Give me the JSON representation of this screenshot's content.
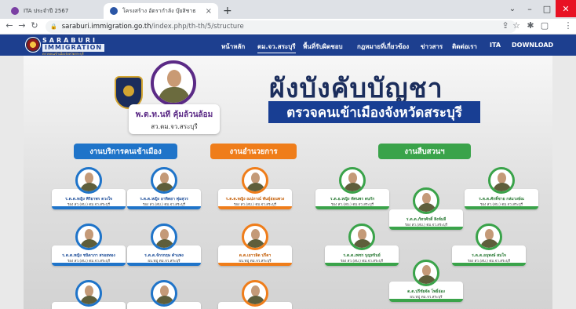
{
  "browser": {
    "tabs": [
      {
        "title": "ITA ประจำปี 2567",
        "close": "×"
      },
      {
        "title": "โครงสร้าง อัตรากำลัง บุ๊ยสิชาธ",
        "close": "×"
      }
    ],
    "new_tab": "+",
    "url_host": "saraburi.immigration.go.th",
    "url_path": "/index.php/th-th/5/structure",
    "window_controls": {
      "chevron": "⌄",
      "minimize": "–",
      "maximize": "□",
      "close": "✕"
    },
    "toolbar_icons": {
      "back": "←",
      "forward": "→",
      "reload": "↻",
      "share": "⇪",
      "star": "☆",
      "extensions": "✱",
      "sidepanel": "▢",
      "menu": "⋮"
    }
  },
  "site": {
    "logo_top": "SARABURI",
    "logo_mid": "IMMIGRATION",
    "logo_sub": "ตรวจคนเข้าเมืองจังหวัดสระบุรี",
    "nav": [
      {
        "label": "หน้าหลัก",
        "active": false
      },
      {
        "label": "ตม.จว.สระบุรี",
        "active": true
      },
      {
        "label": "พื้นที่รับผิดชอบ",
        "active": false
      },
      {
        "label": "กฎหมายที่เกี่ยวข้อง",
        "active": false
      },
      {
        "label": "ข่าวสาร",
        "active": false
      },
      {
        "label": "ติดต่อเรา",
        "active": false
      },
      {
        "label": "ITA",
        "active": false
      },
      {
        "label": "DOWNLOAD",
        "active": false
      }
    ]
  },
  "poster": {
    "title": "ผังบังคับบัญชา",
    "subtitle": "ตรวจคนเข้าเมืองจังหวัดสระบุรี",
    "chief": {
      "name": "พ.ต.ท.นที คุ้มล้วนล้อม",
      "title": "สว.ตม.จว.สระบุรี"
    },
    "sections": [
      "งานบริการคนเข้าเมือง",
      "งานอำนวยการ",
      "งานสืบสวนฯ"
    ],
    "people": [
      {
        "group": "blue",
        "name": "ร.ต.ต.หญิง พิริยาพร ดวงใจ",
        "role": "รอง สว.(สบ.) ตม.จว.สระบุรี"
      },
      {
        "group": "blue",
        "name": "ร.ต.ต.หญิง อาทิตยา พุ่มสุวร",
        "role": "รอง สว.(สบ.) ตม.จว.สระบุรี"
      },
      {
        "group": "blue",
        "name": "ร.ต.ต.หญิง ชนิดาภา สรอยทอง",
        "role": "รอง สว.(สบ.) ตม.จว.สระบุรี"
      },
      {
        "group": "blue",
        "name": "ร.ต.ต.จักรกฤษ คำแพง",
        "role": "ผบ.หมู่ ตม.จว.สระบุรี"
      },
      {
        "group": "orange",
        "name": "ร.ต.ต.หญิง ณปภาณ์ พันธุ์อ่อนพวง",
        "role": "รอง สว.(สบ.) ตม.จว.สระบุรี"
      },
      {
        "group": "orange",
        "name": "ด.ต.เยาวลิด ปรีดา",
        "role": "ผบ.หมู่ ตม.จว.สระบุรี"
      },
      {
        "group": "green",
        "name": "ร.ต.อ.หญิง ทัศนพร ตบกัก",
        "role": "รอง สว.(สบ.) ตม.จว.สระบุรี"
      },
      {
        "group": "green",
        "name": "ร.ต.ต.ภัทรศักดิ์ สิงห์มลี",
        "role": "รอง สว.(สบ.) ตม.จว.สระบุรี"
      },
      {
        "group": "green",
        "name": "ร.ต.ต.ศักดิ์ชาย กล่มวงษ์ณ",
        "role": "รอง สว.(สบ.) ตม.จว.สระบุรี"
      },
      {
        "group": "green",
        "name": "ร.ต.ต.เพชร บุญทริมย์",
        "role": "รอง สว.(สบ.) ตม.จว.สระบุรี"
      },
      {
        "group": "green",
        "name": "ร.ต.ต.อนุพงษ์ สมใจ",
        "role": "รอง สว.(สบ.) ตม.จว.สระบุรี"
      },
      {
        "group": "green",
        "name": "ด.ต.ปรีชัยจัด โพธิ์อ่อง",
        "role": "ผบ.หมู่ ตม.จว.สระบุรี"
      }
    ]
  }
}
